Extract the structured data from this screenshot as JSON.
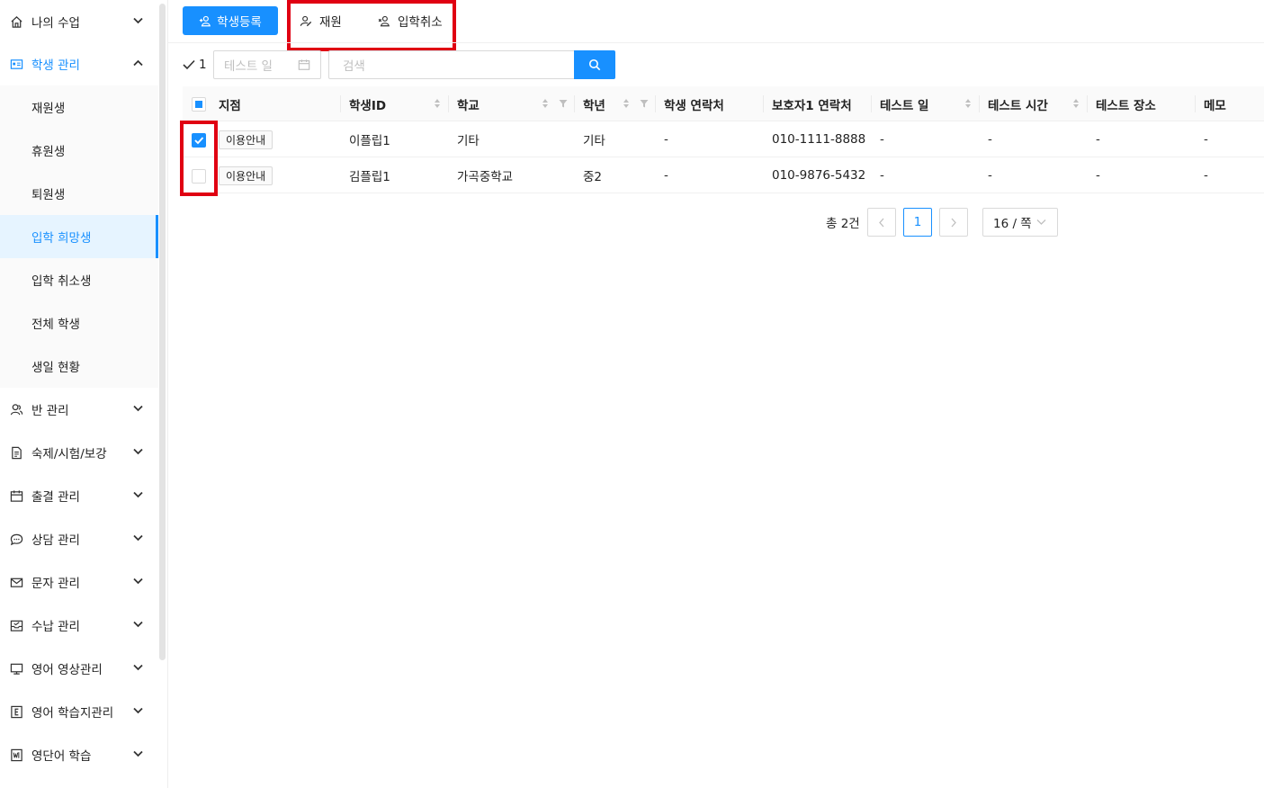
{
  "sidebar": {
    "menu": [
      {
        "label": "나의 수업",
        "icon": "home-icon"
      },
      {
        "label": "학생 관리",
        "icon": "id-card-icon",
        "open": true
      },
      {
        "label": "반 관리",
        "icon": "user-group-icon"
      },
      {
        "label": "숙제/시험/보강",
        "icon": "document-icon"
      },
      {
        "label": "출결 관리",
        "icon": "calendar-icon"
      },
      {
        "label": "상담 관리",
        "icon": "chat-icon"
      },
      {
        "label": "문자 관리",
        "icon": "mail-icon"
      },
      {
        "label": "수납 관리",
        "icon": "invoice-icon"
      },
      {
        "label": "영어 영상관리",
        "icon": "monitor-icon"
      },
      {
        "label": "영어 학습지관리",
        "icon": "e-book-icon"
      },
      {
        "label": "영단어 학습",
        "icon": "word-book-icon"
      }
    ],
    "submenu": [
      {
        "label": "재원생"
      },
      {
        "label": "휴원생"
      },
      {
        "label": "퇴원생"
      },
      {
        "label": "입학 희망생",
        "active": true
      },
      {
        "label": "입학 취소생"
      },
      {
        "label": "전체 학생"
      },
      {
        "label": "생일 현황"
      }
    ]
  },
  "toolbar": {
    "register_label": "학생등록",
    "enroll_label": "재원",
    "cancel_label": "입학취소"
  },
  "filters": {
    "checked_count": "1",
    "date_placeholder": "테스트 일",
    "search_placeholder": "검색"
  },
  "table": {
    "columns": [
      "지점",
      "학생ID",
      "학교",
      "학년",
      "학생 연락처",
      "보호자1 연락처",
      "테스트 일",
      "테스트 시간",
      "테스트 장소",
      "메모"
    ],
    "rows": [
      {
        "checked": true,
        "branch": "이용안내",
        "student_id": "이플립1",
        "school": "기타",
        "grade": "기타",
        "student_phone": "-",
        "parent_phone": "010-1111-8888",
        "test_date": "-",
        "test_time": "-",
        "test_place": "-",
        "memo": "-"
      },
      {
        "checked": false,
        "branch": "이용안내",
        "student_id": "김플립1",
        "school": "가곡중학교",
        "grade": "중2",
        "student_phone": "-",
        "parent_phone": "010-9876-5432",
        "test_date": "-",
        "test_time": "-",
        "test_place": "-",
        "memo": "-"
      }
    ]
  },
  "pagination": {
    "total": "총 2건",
    "current_page": "1",
    "page_size": "16 / 쪽"
  },
  "colors": {
    "accent": "#1890ff",
    "highlight": "#e00012"
  }
}
